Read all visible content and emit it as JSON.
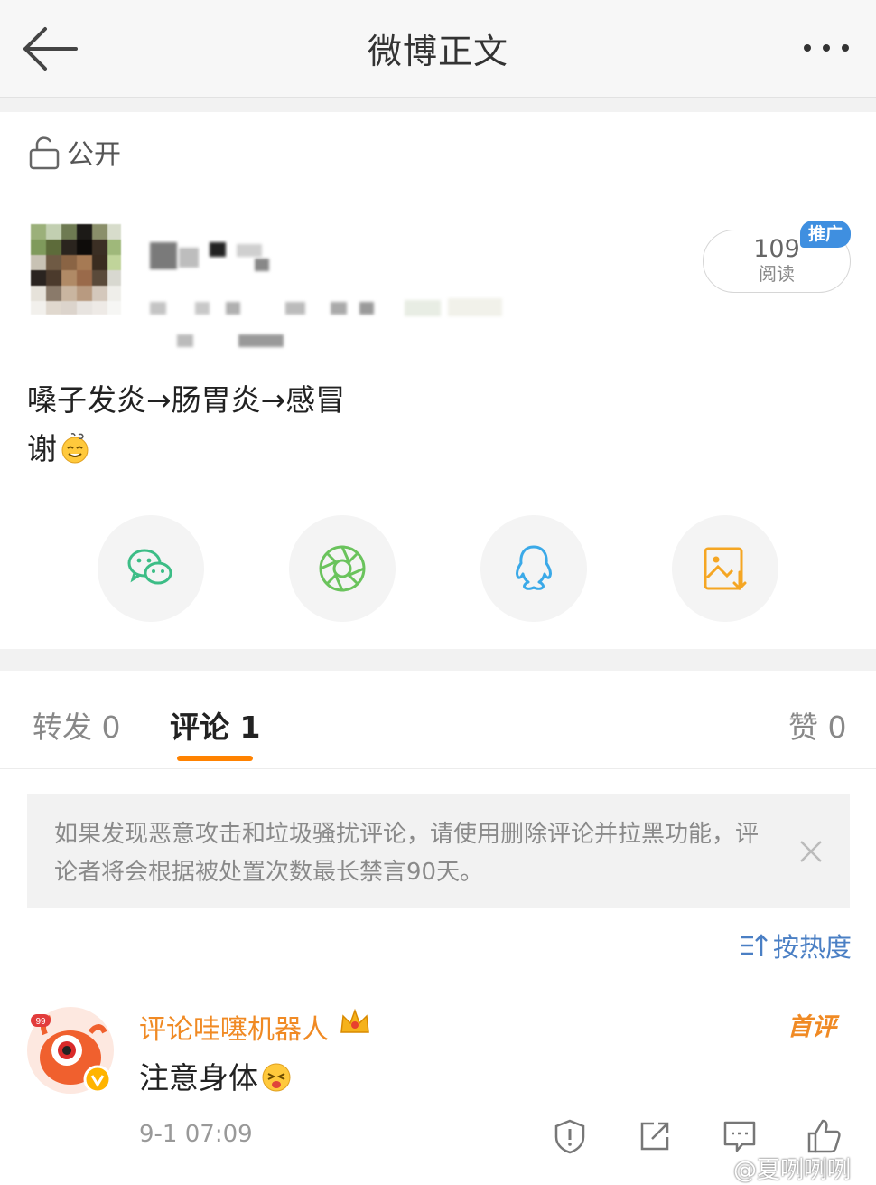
{
  "header": {
    "title": "微博正文"
  },
  "post": {
    "privacy_label": "公开",
    "read_count": "109",
    "read_label": "阅读",
    "promo_badge": "推广",
    "text_line1": "嗓子发炎→肠胃炎→感冒",
    "text_line2": "谢"
  },
  "share": [
    {
      "name": "wechat",
      "icon": "wechat-icon",
      "color": "#3cbd86"
    },
    {
      "name": "moments",
      "icon": "moments-icon",
      "color": "#6ac35c"
    },
    {
      "name": "qq",
      "icon": "qq-icon",
      "color": "#3aa9e8"
    },
    {
      "name": "save-image",
      "icon": "save-image-icon",
      "color": "#f5a623"
    }
  ],
  "tabs": {
    "repost": "转发 0",
    "comment": "评论 1",
    "like": "赞 0"
  },
  "notice": {
    "text": "如果发现恶意攻击和垃圾骚扰评论，请使用删除评论并拉黑功能，评论者将会根据被处置次数最长禁言90天。"
  },
  "sort": {
    "label": "按热度"
  },
  "comment": {
    "username": "评论哇噻机器人",
    "first_badge": "首评",
    "text": "注意身体",
    "time": "9-1 07:09",
    "avatar_badge": "99"
  },
  "watermark": "@夏咧咧咧",
  "colors": {
    "accent": "#ff8200",
    "link": "#4a7fc4",
    "username": "#f08a24"
  }
}
